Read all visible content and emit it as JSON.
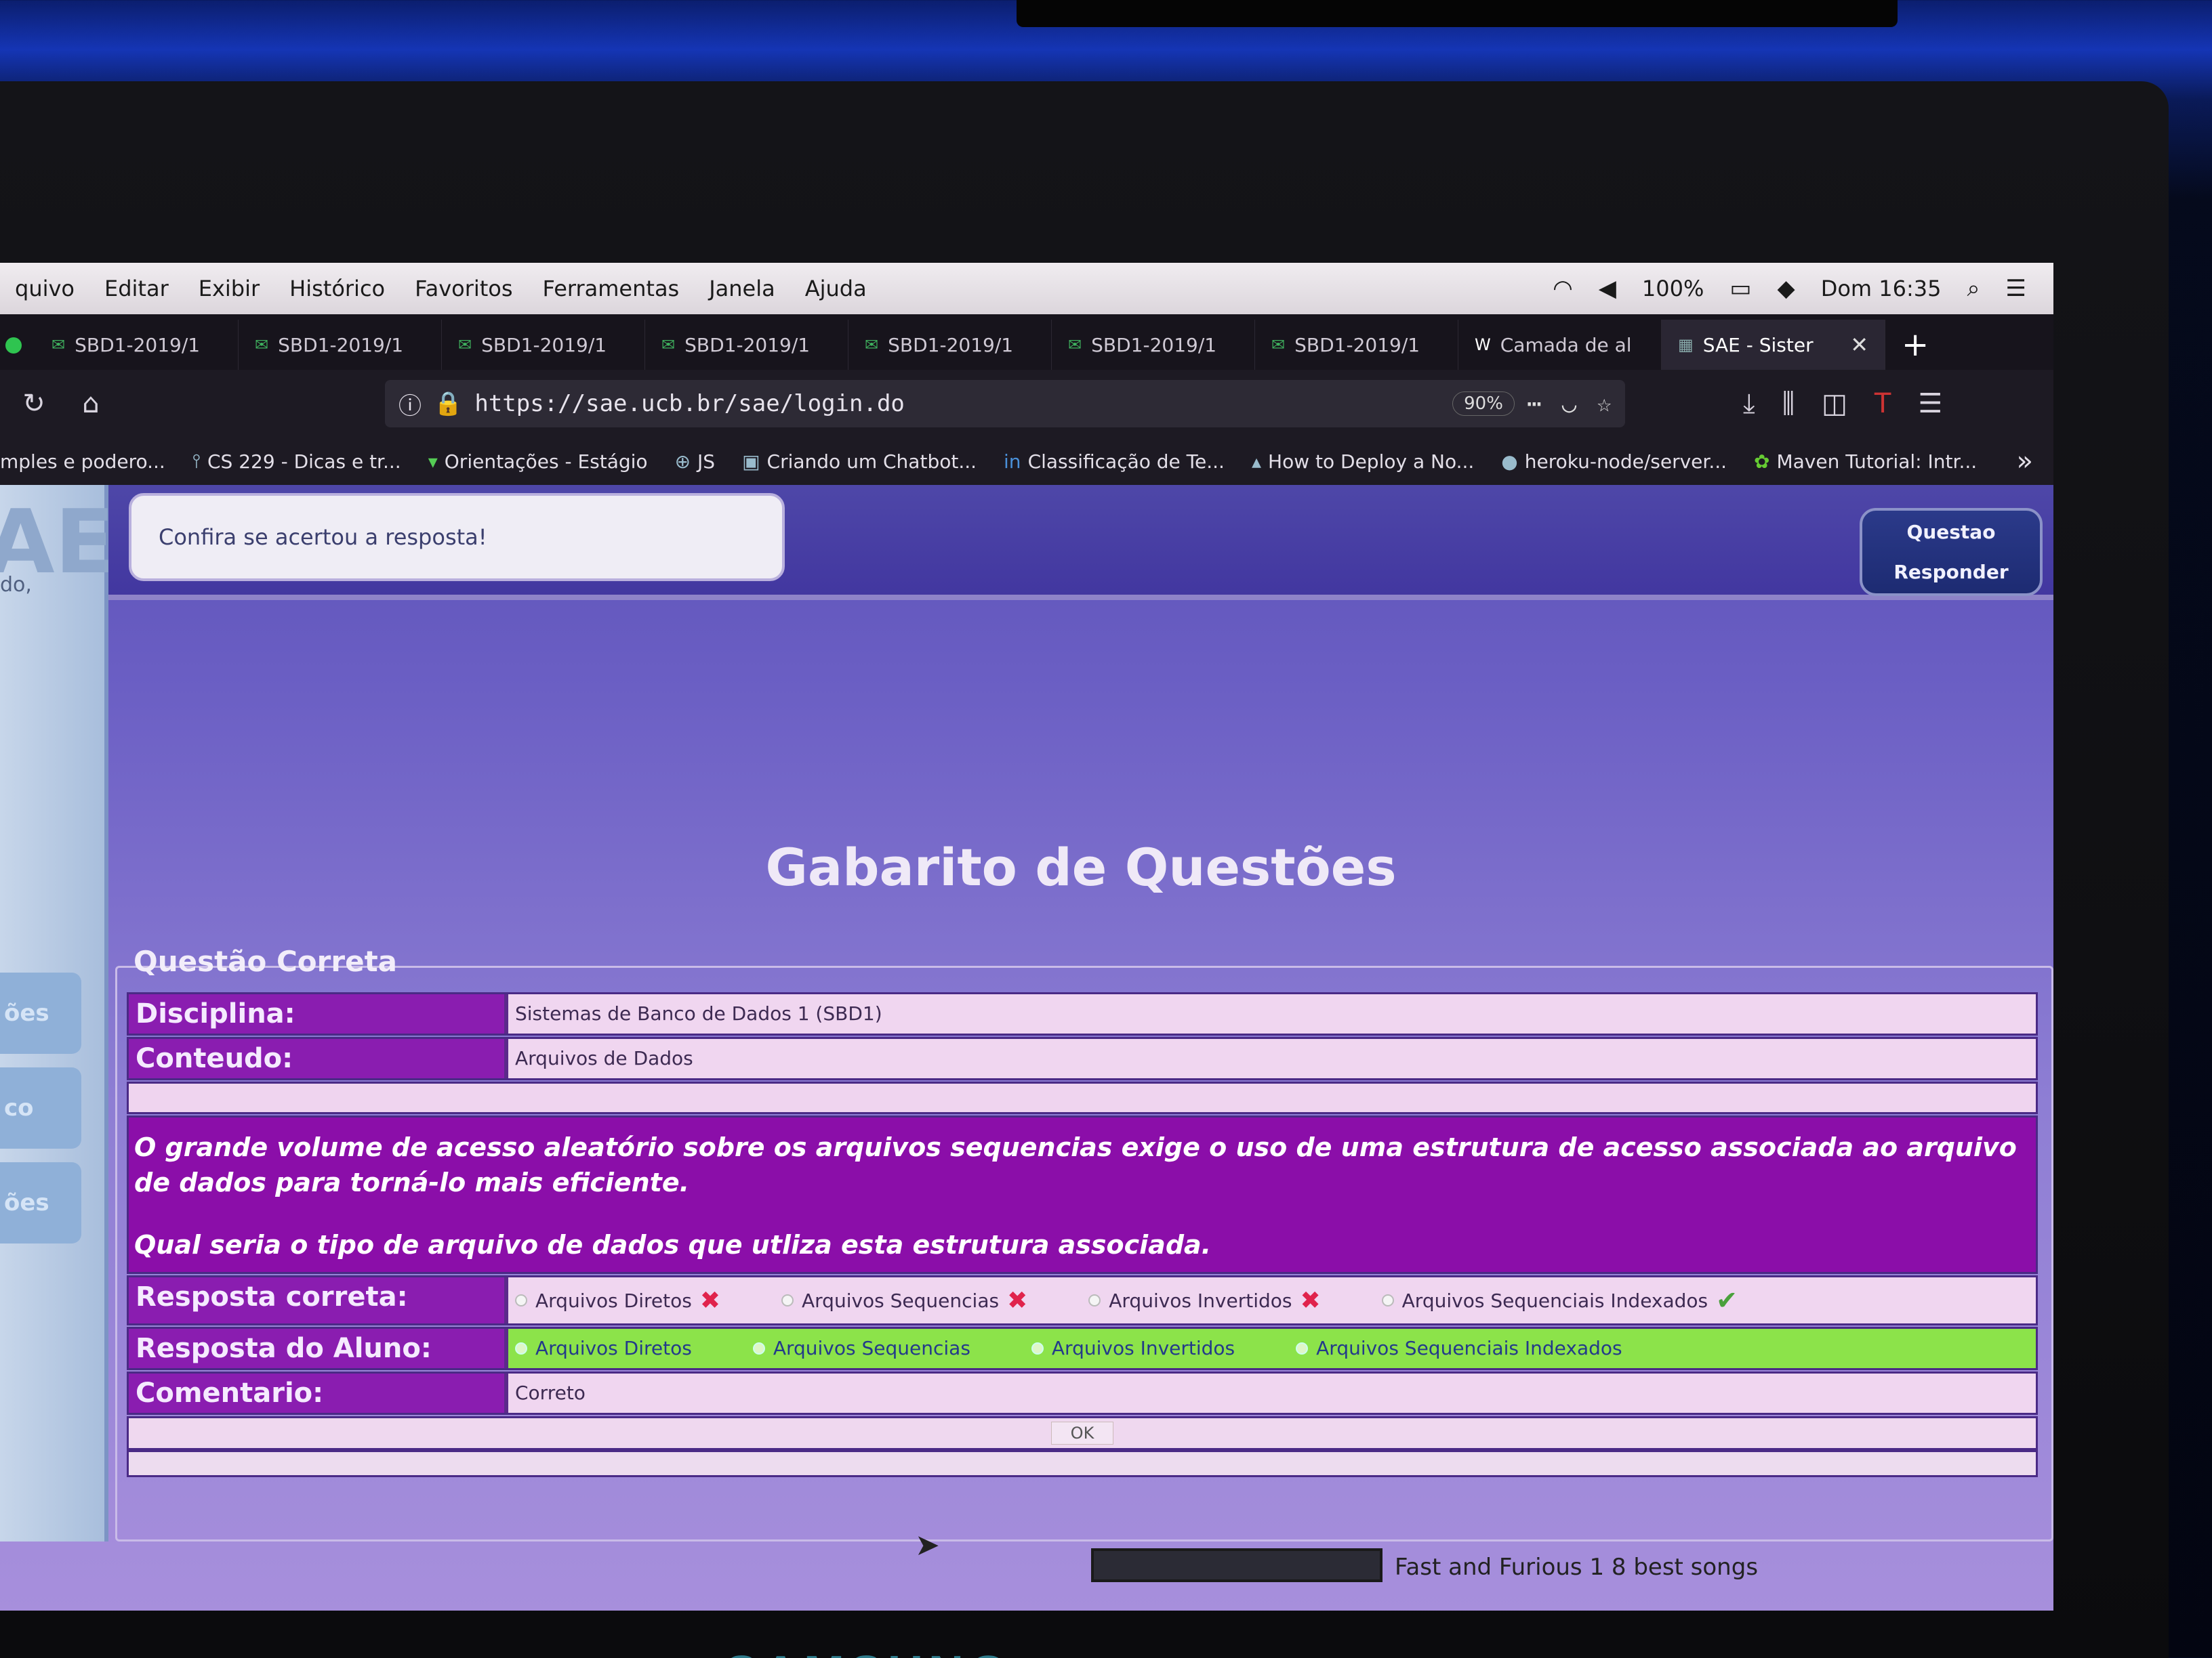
{
  "menubar": {
    "items": [
      "quivo",
      "Editar",
      "Exibir",
      "Histórico",
      "Favoritos",
      "Ferramentas",
      "Janela",
      "Ajuda"
    ],
    "battery": "100%",
    "clock": "Dom 16:35"
  },
  "tabs": [
    {
      "label": "SBD1-2019/1"
    },
    {
      "label": "SBD1-2019/1"
    },
    {
      "label": "SBD1-2019/1"
    },
    {
      "label": "SBD1-2019/1"
    },
    {
      "label": "SBD1-2019/1"
    },
    {
      "label": "SBD1-2019/1"
    },
    {
      "label": "SBD1-2019/1"
    },
    {
      "label": "Camada de al"
    },
    {
      "label": "SAE - Sister"
    }
  ],
  "navbar": {
    "url": "https://sae.ucb.br/sae/login.do",
    "zoom": "90%"
  },
  "bookmarks": [
    "mples e podero...",
    "CS 229 - Dicas e tr...",
    "Orientações - Estágio",
    "JS",
    "Criando um Chatbot...",
    "Classificação de Te...",
    "How to Deploy a No...",
    "heroku-node/server...",
    "Maven Tutorial: Intr..."
  ],
  "sidebar": {
    "logo": "AE",
    "subtitle": "do,",
    "items": [
      "ões",
      "co",
      "ões"
    ]
  },
  "header": {
    "message": "Confira se acertou a resposta!",
    "button_line1": "Questao",
    "button_line2": "Responder"
  },
  "main": {
    "title": "Gabarito de Questões",
    "legend": "Questão Correta",
    "disciplina_label": "Disciplina:",
    "disciplina_value": "Sistemas de Banco de Dados 1 (SBD1)",
    "conteudo_label": "Conteudo:",
    "conteudo_value": "Arquivos de Dados",
    "question_text": "O grande volume de acesso aleatório sobre os arquivos sequencias exige o uso de uma estrutura de acesso associada ao arquivo de dados para torná-lo mais eficiente.",
    "question_prompt": "Qual seria o tipo de arquivo de dados que utliza esta estrutura associada.",
    "correct_label": "Resposta correta:",
    "student_label": "Resposta do Aluno:",
    "comment_label": "Comentario:",
    "comment_value": "Correto",
    "ok_label": "OK",
    "options": [
      {
        "label": "Arquivos Diretos",
        "correct": false
      },
      {
        "label": "Arquivos Sequencias",
        "correct": false
      },
      {
        "label": "Arquivos Invertidos",
        "correct": false
      },
      {
        "label": "Arquivos Sequenciais Indexados",
        "correct": true
      }
    ]
  },
  "taskbar": {
    "media_title": "Fast and Furious 1 8 best songs"
  },
  "monitor": {
    "brand": "SAMSUNG"
  },
  "colors": {
    "label_purple": "#8a1db0",
    "question_purple": "#8b0ea9",
    "student_green": "#8ce34a",
    "wrong_mark": "#e0234c",
    "right_mark": "#4aa03c"
  }
}
